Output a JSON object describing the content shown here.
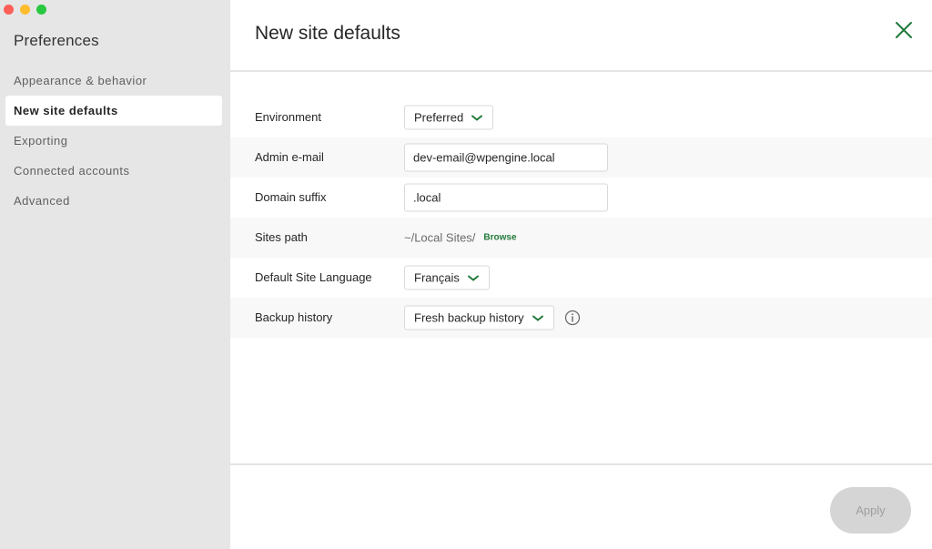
{
  "sidebar": {
    "title": "Preferences",
    "items": [
      {
        "label": "Appearance & behavior"
      },
      {
        "label": "New site defaults"
      },
      {
        "label": "Exporting"
      },
      {
        "label": "Connected accounts"
      },
      {
        "label": "Advanced"
      }
    ],
    "active_index": 1
  },
  "header": {
    "title": "New site defaults",
    "close_icon": "close-x-icon"
  },
  "form": {
    "environment": {
      "label": "Environment",
      "value": "Preferred"
    },
    "admin_email": {
      "label": "Admin e-mail",
      "value": "dev-email@wpengine.local"
    },
    "domain_suffix": {
      "label": "Domain suffix",
      "value": ".local"
    },
    "sites_path": {
      "label": "Sites path",
      "value": "~/Local Sites/",
      "browse_label": "Browse"
    },
    "language": {
      "label": "Default Site Language",
      "value": "Français"
    },
    "backup_history": {
      "label": "Backup history",
      "value": "Fresh backup history",
      "info_icon": "info-icon"
    }
  },
  "footer": {
    "apply_label": "Apply",
    "apply_enabled": false
  },
  "colors": {
    "accent": "#217a3a",
    "sidebar_bg": "#e6e6e6",
    "alt_row_bg": "#f8f8f8",
    "disabled_button": "#d5d5d5"
  }
}
